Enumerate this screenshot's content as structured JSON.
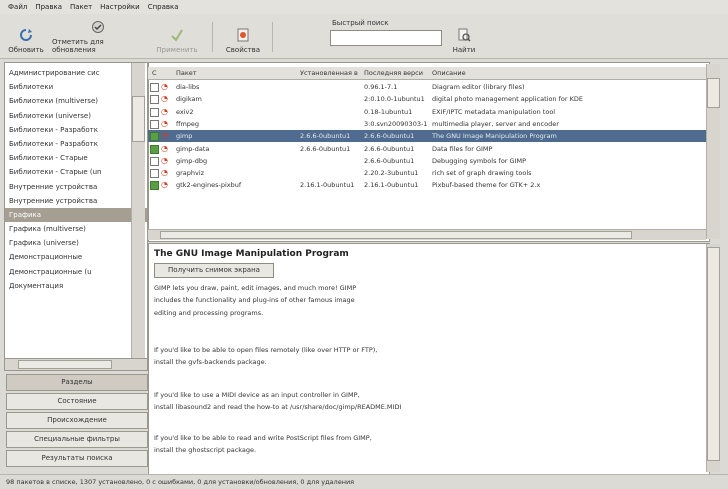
{
  "menu": [
    "Файл",
    "Правка",
    "Пакет",
    "Настройки",
    "Справка"
  ],
  "toolbar": {
    "reload": "Обновить",
    "mark_all": "Отметить для обновления",
    "apply": "Применить",
    "properties": "Свойства",
    "search_label": "Быстрый поиск",
    "search_value": "",
    "find": "Найти"
  },
  "sections": [
    "Администрирование сис",
    "Библиотеки",
    "Библиотеки (multiverse)",
    "Библиотеки (universe)",
    "Библиотеки - Разработк",
    "Библиотеки - Разработк",
    "Библиотеки - Старые",
    "Библиотеки - Старые (un",
    "Внутренние устройства",
    "Внутренние устройства",
    "Графика",
    "Графика (multiverse)",
    "Графика (universe)",
    "Демонстрационные",
    "Демонстрационные (u",
    "Документация"
  ],
  "selected_section_index": 10,
  "filter_buttons": [
    "Разделы",
    "Состояние",
    "Происхождение",
    "Специальные фильтры",
    "Результаты поиска"
  ],
  "table": {
    "headers": [
      "С",
      "Пакет",
      "Установленная в",
      "Последняя верси",
      "Описание"
    ],
    "rows": [
      {
        "name": "dia-libs",
        "installed": "",
        "latest": "0.96.1-7.1",
        "desc": "Diagram editor (library files)",
        "state": "none"
      },
      {
        "name": "digikam",
        "installed": "",
        "latest": "2:0.10.0-1ubuntu1",
        "desc": "digital photo management application for KDE",
        "state": "none"
      },
      {
        "name": "exiv2",
        "installed": "",
        "latest": "0.18-1ubuntu1",
        "desc": "EXIF/IPTC metadata manipulation tool",
        "state": "none"
      },
      {
        "name": "ffmpeg",
        "installed": "",
        "latest": "3:0.svn20090303-1",
        "desc": "multimedia player, server and encoder",
        "state": "none"
      },
      {
        "name": "gimp",
        "installed": "2.6.6-0ubuntu1",
        "latest": "2.6.6-0ubuntu1",
        "desc": "The GNU Image Manipulation Program",
        "state": "installed",
        "selected": true
      },
      {
        "name": "gimp-data",
        "installed": "2.6.6-0ubuntu1",
        "latest": "2.6.6-0ubuntu1",
        "desc": "Data files for GIMP",
        "state": "installed"
      },
      {
        "name": "gimp-dbg",
        "installed": "",
        "latest": "2.6.6-0ubuntu1",
        "desc": "Debugging symbols for GIMP",
        "state": "none"
      },
      {
        "name": "graphviz",
        "installed": "",
        "latest": "2.20.2-3ubuntu1",
        "desc": "rich set of graph drawing tools",
        "state": "none"
      },
      {
        "name": "gtk2-engines-pixbuf",
        "installed": "2.16.1-0ubuntu1",
        "latest": "2.16.1-0ubuntu1",
        "desc": "Pixbuf-based theme for GTK+ 2.x",
        "state": "installed"
      }
    ]
  },
  "details": {
    "title": "The GNU Image Manipulation Program",
    "screenshot_button": "Получить снимок экрана",
    "paragraphs": [
      "GIMP lets you draw, paint, edit images, and much more! GIMP\nincludes the functionality and plug-ins of other famous image\nediting and processing programs.",
      "If you'd like to be able to open files remotely (like over HTTP or FTP),\ninstall the gvfs-backends package.",
      "If you'd like to use a MIDI device as an input controller in GIMP,\ninstall libasound2 and read the how-to at /usr/share/doc/gimp/README.MIDI",
      "If you'd like to be able to read and write PostScript files from GIMP,\ninstall the ghostscript package."
    ]
  },
  "status": "98 пакетов в списке, 1307 установлено, 0 с ошибками, 0 для установки/обновления, 0 для удаления"
}
